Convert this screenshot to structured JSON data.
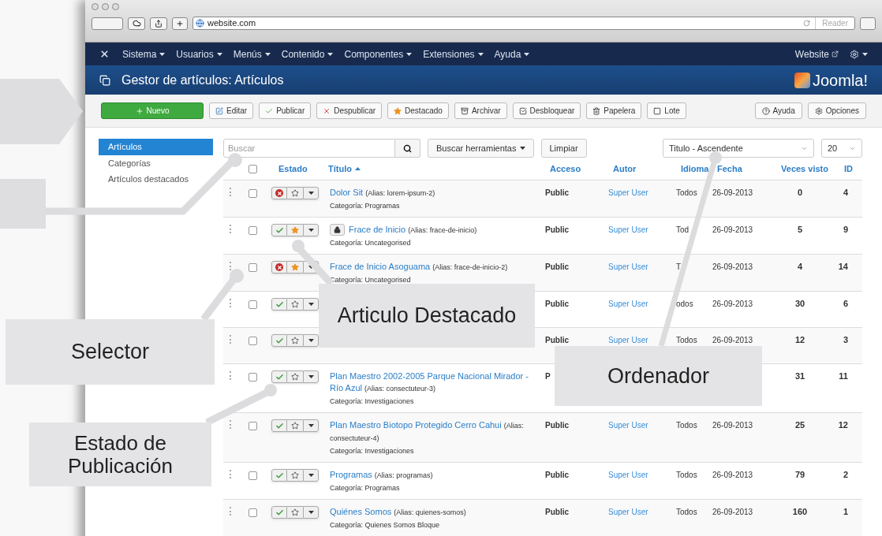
{
  "browser": {
    "url": "website.com",
    "reader": "Reader"
  },
  "nav": {
    "menus": [
      {
        "label": "Sistema"
      },
      {
        "label": "Usuarios"
      },
      {
        "label": "Menús"
      },
      {
        "label": "Contenido"
      },
      {
        "label": "Componentes"
      },
      {
        "label": "Extensiones"
      },
      {
        "label": "Ayuda"
      }
    ],
    "site_link": "Website"
  },
  "header": {
    "title": "Gestor de artículos: Artículos",
    "logo": "Joomla!"
  },
  "toolbar": {
    "buttons": [
      {
        "label": "Nuevo",
        "kind": "primary"
      },
      {
        "label": "Editar",
        "kind": "default"
      },
      {
        "label": "Publicar",
        "kind": "default"
      },
      {
        "label": "Despublicar",
        "kind": "default"
      },
      {
        "label": "Destacado",
        "kind": "default"
      },
      {
        "label": "Archivar",
        "kind": "default"
      },
      {
        "label": "Desbloquear",
        "kind": "default"
      },
      {
        "label": "Papelera",
        "kind": "default"
      },
      {
        "label": "Lote",
        "kind": "default"
      }
    ],
    "right_buttons": [
      {
        "label": "Ayuda"
      },
      {
        "label": "Opciones"
      }
    ]
  },
  "sidebar": [
    {
      "label": "Artículos",
      "selected": true
    },
    {
      "label": "Categorías",
      "selected": false
    },
    {
      "label": "Artículos destacados",
      "selected": false
    }
  ],
  "filters": {
    "search_placeholder": "Buscar",
    "search_tools": "Buscar herramientas",
    "clear": "Limpiar",
    "ordering": "Titulo - Ascendente",
    "limit": "20"
  },
  "table": {
    "select_all_checked": false,
    "columns": {
      "estado": "Estado",
      "titulo": "Título",
      "acceso": "Acceso",
      "autor": "Autor",
      "idioma": "Idioma",
      "fecha": "Fecha",
      "visto": "Veces visto",
      "id": "ID"
    },
    "rows": [
      {
        "checked": false,
        "title": "Dolor Sit",
        "alias": "(Alias: lorem-ipsum-2)",
        "category": "Categoría: Programas",
        "published": false,
        "featured": false,
        "locked": false,
        "access": "Public",
        "author": "Super User",
        "language": "Todos",
        "date": "26-09-2013",
        "hits": "0",
        "id": "4"
      },
      {
        "checked": false,
        "title": "Frace de Inicio",
        "alias": "(Alias: frace-de-inicio)",
        "category": "Categoría: Uncategorised",
        "published": true,
        "featured": true,
        "locked": true,
        "access": "Public",
        "author": "Super User",
        "language": "Tod",
        "date": "26-09-2013",
        "hits": "5",
        "id": "9"
      },
      {
        "checked": false,
        "title": "Frace de Inicio Asoguama",
        "alias": "(Alias: frace-de-inicio-2)",
        "category": "Categoría: Uncategorised",
        "published": false,
        "featured": true,
        "locked": false,
        "access": "Public",
        "author": "Super User",
        "language": "T",
        "date": "26-09-2013",
        "hits": "4",
        "id": "14"
      },
      {
        "checked": false,
        "published": true,
        "featured": false,
        "locked": false,
        "access": "Public",
        "author": "Super User",
        "language": "odos",
        "date": "26-09-2013",
        "hits": "30",
        "id": "6"
      },
      {
        "checked": false,
        "published": true,
        "featured": false,
        "locked": false,
        "access": "Public",
        "author": "Super User",
        "language": "Todos",
        "date": "26-09-2013",
        "hits": "12",
        "id": "3"
      },
      {
        "checked": false,
        "title": "Plan Maestro 2002-2005 Parque Nacional Mirador - Río Azul",
        "alias": "(Alias: consectuteur-3)",
        "category": "Categoría: Investigaciones",
        "published": true,
        "featured": false,
        "locked": false,
        "access": "P",
        "hits": "31",
        "id": "11"
      },
      {
        "checked": false,
        "title": "Plan Maestro Biotopo Protegido Cerro Cahui",
        "alias": "(Alias: consectuteur-4)",
        "category": "Categoría: Investigaciones",
        "published": true,
        "featured": false,
        "locked": false,
        "access": "Public",
        "author": "Super User",
        "language": "Todos",
        "date": "26-09-2013",
        "hits": "25",
        "id": "12"
      },
      {
        "checked": false,
        "title": "Programas",
        "alias": "(Alias: programas)",
        "category": "Categoría: Programas",
        "published": true,
        "featured": false,
        "locked": false,
        "access": "Public",
        "author": "Super User",
        "language": "Todos",
        "date": "26-09-2013",
        "hits": "79",
        "id": "2"
      },
      {
        "checked": false,
        "title": "Quiénes Somos",
        "alias": "(Alias: quienes-somos)",
        "category": "Categoría: Quienes Somos Bloque",
        "published": true,
        "featured": false,
        "locked": false,
        "access": "Public",
        "author": "Super User",
        "language": "Todos",
        "date": "26-09-2013",
        "hits": "160",
        "id": "1"
      }
    ]
  },
  "callouts": [
    {
      "text": "Articulo Destacado"
    },
    {
      "text": "Selector"
    },
    {
      "text": "Ordenador"
    },
    {
      "text": "Estado de Publicación"
    }
  ]
}
